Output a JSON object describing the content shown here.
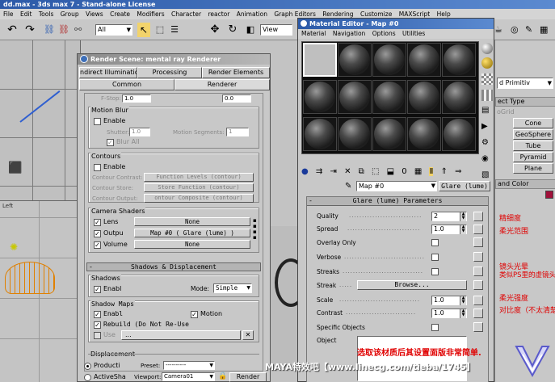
{
  "app": {
    "title": "dd.max - 3ds max 7 - Stand-alone License",
    "menu": [
      "File",
      "Edit",
      "Tools",
      "Group",
      "Views",
      "Create",
      "Modifiers",
      "Character",
      "reactor",
      "Animation",
      "Graph Editors",
      "Rendering",
      "Customize",
      "MAXScript",
      "Help"
    ],
    "toolbar_filter": "All",
    "toolbar_view": "View"
  },
  "viewport": {
    "label": "Left"
  },
  "right_panel": {
    "dropdown": "d Primitiv",
    "object_type": "ect Type",
    "autogrid": "oGrid",
    "buttons": [
      "Cone",
      "GeoSphere",
      "Tube",
      "Pyramid",
      "Plane"
    ],
    "name_color": "and Color"
  },
  "render_scene": {
    "title": "Render Scene: mental ray Renderer",
    "tabs_row1": [
      "ndirect Illuminatio",
      "Processing",
      "Render Elements"
    ],
    "tabs_row2": [
      "Common",
      "Renderer"
    ],
    "fstop_label": "F-Stop:",
    "fstop_value": "1.0",
    "fstop_value2": "0.0",
    "motion_blur": {
      "title": "Motion Blur",
      "enable": "Enable",
      "shutter_label": "Shutter:",
      "shutter_value": "1.0",
      "segments_label": "Motion Segments:",
      "segments_value": "1",
      "blur_all": "Blur All"
    },
    "contours": {
      "title": "Contours",
      "enable": "Enable",
      "contrast_label": "Contour Contrast:",
      "contrast_value": "Function Levels (contour)",
      "store_label": "Contour Store:",
      "store_value": "Store Function (contour)",
      "output_label": "Contour Output:",
      "output_value": "ontour Composite (contour)"
    },
    "camera_shaders": {
      "title": "Camera Shaders",
      "lens": "Lens",
      "lens_value": "None",
      "output": "Outpu",
      "output_value": "Map #0  ( Glare (lume) )",
      "volume": "Volume",
      "volume_value": "None"
    },
    "rollout_title": "Shadows & Displacement",
    "shadows": {
      "title": "Shadows",
      "enable": "Enabl",
      "mode_label": "Mode:",
      "mode_value": "Simple"
    },
    "shadow_maps": {
      "title": "Shadow Maps",
      "enable": "Enabl",
      "motion": "Motion",
      "rebuild": "Rebuild (Do Not Re-Use",
      "use": "Use",
      "use_value": "..."
    },
    "displacement": "Displacement",
    "production": "Producti",
    "activeshade": "ActiveSha",
    "preset_label": "Preset:",
    "preset_value": "----------",
    "viewport_label": "Viewport:",
    "viewport_value": "Camera01",
    "render_button": "Render"
  },
  "material_editor": {
    "title": "Material Editor - Map #0",
    "menu": [
      "Material",
      "Navigation",
      "Options",
      "Utilities"
    ],
    "map_name": "Map #0",
    "map_type": "Glare (lume)",
    "rollout_title": "Glare (lume) Parameters",
    "params": [
      {
        "label": "Quality",
        "value": "2",
        "annotation": "精细度"
      },
      {
        "label": "Spread",
        "value": "1.0",
        "annotation": "柔光范围"
      },
      {
        "label": "Overlay Only",
        "value": "",
        "annotation": ""
      },
      {
        "label": "Verbose",
        "value": "",
        "annotation": ""
      },
      {
        "label": "Streaks",
        "value": "",
        "annotation": "镜头光晕"
      },
      {
        "label": "Streak",
        "value": "Browse...",
        "annotation": ""
      },
      {
        "label": "Scale",
        "value": "1.0",
        "annotation": "柔光强度"
      },
      {
        "label": "Contrast",
        "value": "1.0",
        "annotation": "对比度（不太清楚"
      },
      {
        "label": "Specific Objects",
        "value": "",
        "annotation": ""
      },
      {
        "label": "Object",
        "value": "",
        "annotation": ""
      }
    ],
    "streaks_note": "类似PS里的虚镜头",
    "bottom_note": "选取该材质后其设置面版非常简单."
  },
  "watermark": {
    "text": "MAYA特效吧【www.linecg.com/tieba/1745】"
  }
}
